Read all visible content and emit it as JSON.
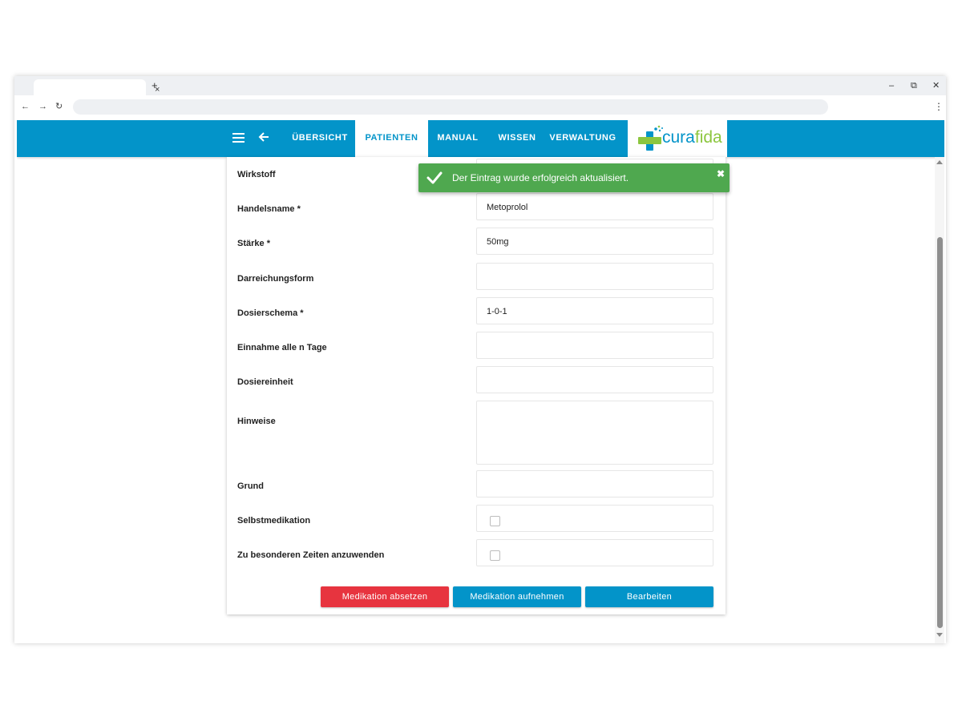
{
  "browser": {
    "tab_close": "×",
    "new_tab": "+",
    "window_controls": {
      "minimize": "–",
      "restore": "⧉",
      "close": "✕"
    },
    "nav": {
      "back": "←",
      "forward": "→",
      "reload": "↻"
    },
    "menu": "⋮"
  },
  "appbar": {
    "nav_items": [
      {
        "label": "ÜBERSICHT",
        "active": false
      },
      {
        "label": "PATIENTEN",
        "active": true
      },
      {
        "label": "MANUAL",
        "active": false
      },
      {
        "label": "WISSEN",
        "active": false
      },
      {
        "label": "VERWALTUNG",
        "active": false
      }
    ],
    "logo": {
      "part1": "cura",
      "part2": "fida"
    },
    "colors": {
      "primary": "#0394c9",
      "logo_green": "#8cc63f"
    }
  },
  "form": {
    "fields": [
      {
        "label": "Wirkstoff",
        "value": ""
      },
      {
        "label": "Handelsname *",
        "value": "Metoprolol"
      },
      {
        "label": "Stärke *",
        "value": "50mg"
      },
      {
        "label": "Darreichungsform",
        "value": ""
      },
      {
        "label": "Dosierschema *",
        "value": "1-0-1"
      },
      {
        "label": "Einnahme alle n Tage",
        "value": ""
      },
      {
        "label": "Dosiereinheit",
        "value": ""
      },
      {
        "label": "Hinweise",
        "value": ""
      },
      {
        "label": "Grund",
        "value": ""
      },
      {
        "label": "Selbstmedikation",
        "checked": false
      },
      {
        "label": "Zu besonderen Zeiten anzuwenden",
        "checked": false
      }
    ],
    "buttons": {
      "discontinue": "Medikation absetzen",
      "add": "Medikation aufnehmen",
      "edit": "Bearbeiten"
    },
    "colors": {
      "danger": "#e7343f",
      "primary": "#0394c9"
    }
  },
  "toast": {
    "message": "Der Eintrag wurde erfolgreich aktualisiert.",
    "close": "✖",
    "color": "#4fa84f"
  }
}
